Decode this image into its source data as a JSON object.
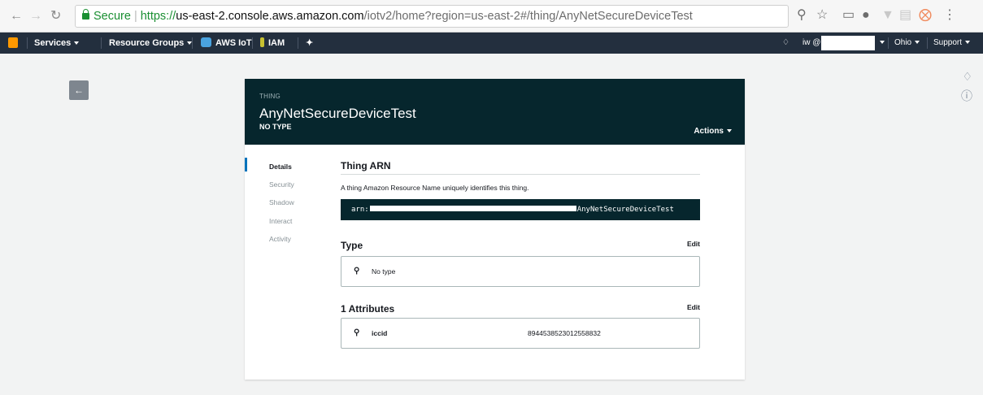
{
  "browser": {
    "secure_label": "Secure",
    "url_scheme": "https://",
    "url_host": "us-east-2.console.aws.amazon.com",
    "url_path": "/iotv2/home?region=us-east-2#/thing/AnyNetSecureDeviceTest"
  },
  "awsnav": {
    "services": "Services",
    "resource_groups": "Resource Groups",
    "aws_iot": "AWS IoT",
    "iam": "IAM",
    "account_prefix": "iw @",
    "region": "Ohio",
    "support": "Support"
  },
  "thing": {
    "kicker": "THING",
    "name": "AnyNetSecureDeviceTest",
    "type_label": "NO TYPE",
    "actions": "Actions"
  },
  "tabs": [
    "Details",
    "Security",
    "Shadow",
    "Interact",
    "Activity"
  ],
  "details": {
    "arn_title": "Thing ARN",
    "arn_desc": "A thing Amazon Resource Name uniquely identifies this thing.",
    "arn_prefix": "arn:",
    "arn_suffix": "AnyNetSecureDeviceTest",
    "type_title": "Type",
    "type_edit": "Edit",
    "type_value": "No type",
    "attributes_title": "1 Attributes",
    "attributes_edit": "Edit",
    "attributes": [
      {
        "key": "iccid",
        "value": "8944538523012558832"
      }
    ]
  },
  "colors": {
    "header_bg": "#06262d",
    "aws_nav_bg": "#232f3e",
    "accent": "#0073bb"
  }
}
